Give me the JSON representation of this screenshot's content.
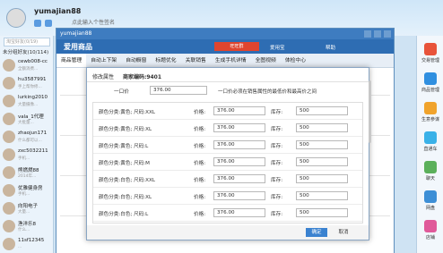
{
  "messenger": {
    "username": "yumajian88",
    "signature": "点此输入个性签名",
    "search_placeholder": "淘宝好友(0/19)",
    "group_label": "未分组好友(10/114)",
    "contacts": [
      {
        "name": "cewb008-cc",
        "status": "全额消费..."
      },
      {
        "name": "hu3587991",
        "status": "手上帮你修..."
      },
      {
        "name": "lurking2010",
        "status": "大量摄像..."
      },
      {
        "name": "vala_1代理",
        "status": "大批量..."
      },
      {
        "name": "zhaojun171",
        "status": "什么都可以..."
      },
      {
        "name": "zxc5032211",
        "status": "手机..."
      },
      {
        "name": "熊燃燃88",
        "status": "2014年..."
      },
      {
        "name": "优雅健身房",
        "status": "手机..."
      },
      {
        "name": "向阳电子",
        "status": "大量..."
      },
      {
        "name": "渔洋乐8",
        "status": "什么..."
      },
      {
        "name": "11sf12345",
        "status": "..."
      }
    ]
  },
  "app_window": {
    "title": "yumajian88",
    "brand": "爱用商品",
    "promo_button": "旺旺群",
    "user1": "爱用宝",
    "user2": "帮助",
    "nav": [
      "商品管理",
      "自动上下架",
      "自动橱窗",
      "标题优化",
      "关联销售",
      "生成手机详情",
      "全图视频",
      "体检中心"
    ]
  },
  "modal": {
    "title": "修改属性",
    "merchant_code": "商家编码:9401",
    "uniform_label": "一口价",
    "uniform_value": "376.00",
    "uniform_hint": "一口价必须在销售属性的最低价和最高价之间",
    "price_label": "价格:",
    "stock_label": "库存:",
    "rows": [
      {
        "attr": "颜色分类:黄色; 尺码:XXL",
        "price": "376.00",
        "stock": "500"
      },
      {
        "attr": "颜色分类:黄色; 尺码:XL",
        "price": "376.00",
        "stock": "500"
      },
      {
        "attr": "颜色分类:黄色; 尺码:L",
        "price": "376.00",
        "stock": "500"
      },
      {
        "attr": "颜色分类:黄色; 尺码:M",
        "price": "376.00",
        "stock": "500"
      },
      {
        "attr": "颜色分类:白色; 尺码:XXL",
        "price": "376.00",
        "stock": "500"
      },
      {
        "attr": "颜色分类:白色; 尺码:XL",
        "price": "376.00",
        "stock": "500"
      },
      {
        "attr": "颜色分类:白色; 尺码:L",
        "price": "376.00",
        "stock": "500"
      }
    ],
    "ok_label": "确定",
    "cancel_label": "取消"
  },
  "right_apps": [
    "交易管理",
    "商品管理",
    "生意参谋",
    "直通车",
    "聊天",
    "网盘",
    "店铺"
  ]
}
